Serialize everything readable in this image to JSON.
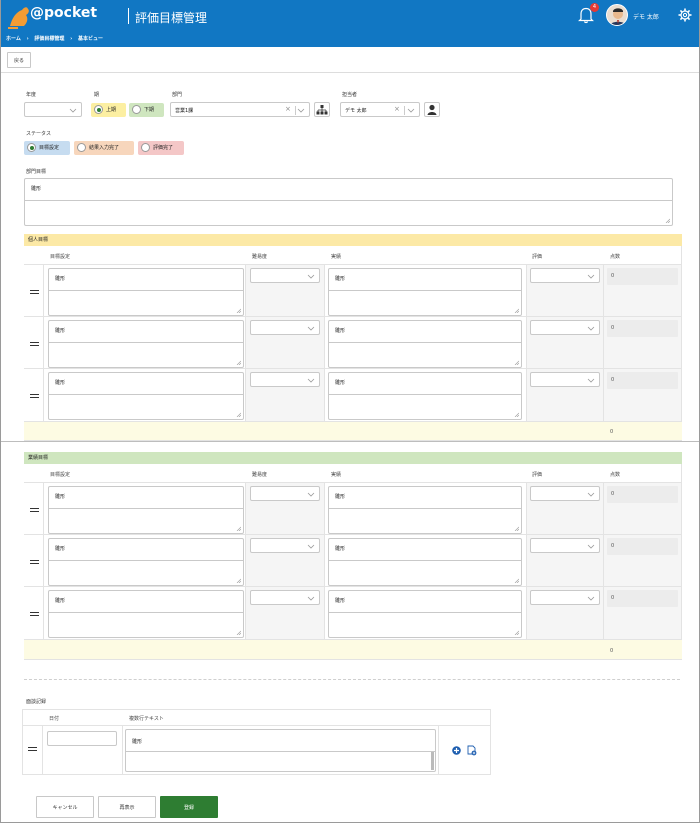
{
  "app": {
    "logo_text": "@pocket",
    "page_title": "評価目標管理",
    "notifications": "4",
    "user_name": "デモ 太郎"
  },
  "breadcrumb": [
    "ホーム",
    "›",
    "評価目標管理",
    "›",
    "基本ビュー"
  ],
  "toolbar": {
    "back_label": "戻る"
  },
  "form": {
    "year_label": "年度",
    "year_value": "",
    "term_label": "期",
    "term_options": [
      "上期",
      "下期"
    ],
    "term_selected": "上期",
    "dept_label": "部門",
    "dept_value": "営業1課",
    "owner_label": "担当者",
    "owner_value": "デモ 太郎",
    "status_label": "ステータス",
    "status_options": [
      "目標設定",
      "結果入力完了",
      "評価完了"
    ],
    "status_selected": "目標設定",
    "dept_goal_label": "部門目標",
    "dept_goal_value": "雛形"
  },
  "personal": {
    "title": "個人目標",
    "headers": [
      "目標設定",
      "難易度",
      "実績",
      "評価",
      "点数"
    ],
    "rows": [
      {
        "goal": "雛形",
        "result": "雛形",
        "score": "0"
      },
      {
        "goal": "雛形",
        "result": "雛形",
        "score": "0"
      },
      {
        "goal": "雛形",
        "result": "雛形",
        "score": "0"
      }
    ],
    "total": "0"
  },
  "performance": {
    "title": "業績目標",
    "headers": [
      "目標設定",
      "難易度",
      "実績",
      "評価",
      "点数"
    ],
    "rows": [
      {
        "goal": "雛形",
        "result": "雛形",
        "score": "0"
      },
      {
        "goal": "雛形",
        "result": "雛形",
        "score": "0"
      },
      {
        "goal": "雛形",
        "result": "雛形",
        "score": "0"
      }
    ],
    "total": "0"
  },
  "interview": {
    "title": "面談記録",
    "headers": [
      "日付",
      "複数行テキスト"
    ],
    "row": {
      "date": "",
      "text": "雛形"
    }
  },
  "actions": {
    "cancel": "キャンセル",
    "redisplay": "再表示",
    "register": "登録"
  },
  "colors": {
    "header": "#1177c3",
    "personal_bar": "#fce9a6",
    "performance_bar": "#cfe6bf",
    "primary": "#2e7d32"
  }
}
